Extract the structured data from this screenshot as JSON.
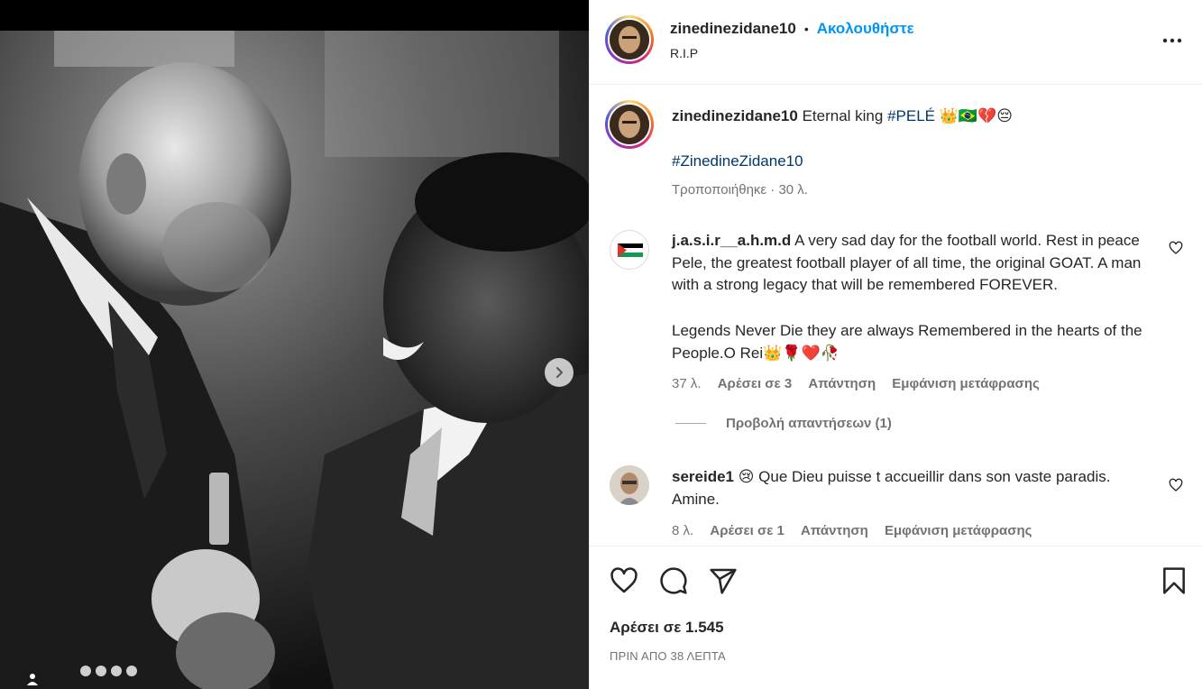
{
  "post": {
    "username": "zinedinezidane10",
    "separator": "•",
    "follow_label": "Ακολουθήστε",
    "location": "R.I.P",
    "more_icon": "more-horizontal-icon"
  },
  "caption": {
    "username": "zinedinezidane10",
    "text": "Eternal king",
    "hashtag_1": "#PELÉ",
    "emojis": "👑🇧🇷💔😔",
    "hashtag_2": "#ZinedineZidane10",
    "edited_label": "Τροποποιήθηκε · 30 λ."
  },
  "comments": [
    {
      "username": "j.a.s.i.r__a.h.m.d",
      "text": "A very sad day for the football world. Rest in peace Pele, the greatest football player of all time, the original GOAT. A man with a strong legacy that will be remembered FOREVER.",
      "text_2": "Legends Never Die they are always Remembered in the hearts of the People.O Rei👑🌹❤️🥀",
      "time": "37 λ.",
      "likes": "Αρέσει σε 3",
      "reply": "Απάντηση",
      "translate": "Εμφάνιση μετάφρασης",
      "view_replies": "Προβολή απαντήσεων (1)"
    },
    {
      "username": "sereide1",
      "text": "😢 Que Dieu puisse t accueillir dans son vaste paradis. Amine.",
      "time": "8 λ.",
      "likes": "Αρέσει σε 1",
      "reply": "Απάντηση",
      "translate": "Εμφάνιση μετάφρασης"
    }
  ],
  "actions": {
    "likes_count": "Αρέσει σε 1.545",
    "timestamp": "ΠΡΙΝ ΑΠΟ 38 ΛΕΠΤΑ"
  }
}
